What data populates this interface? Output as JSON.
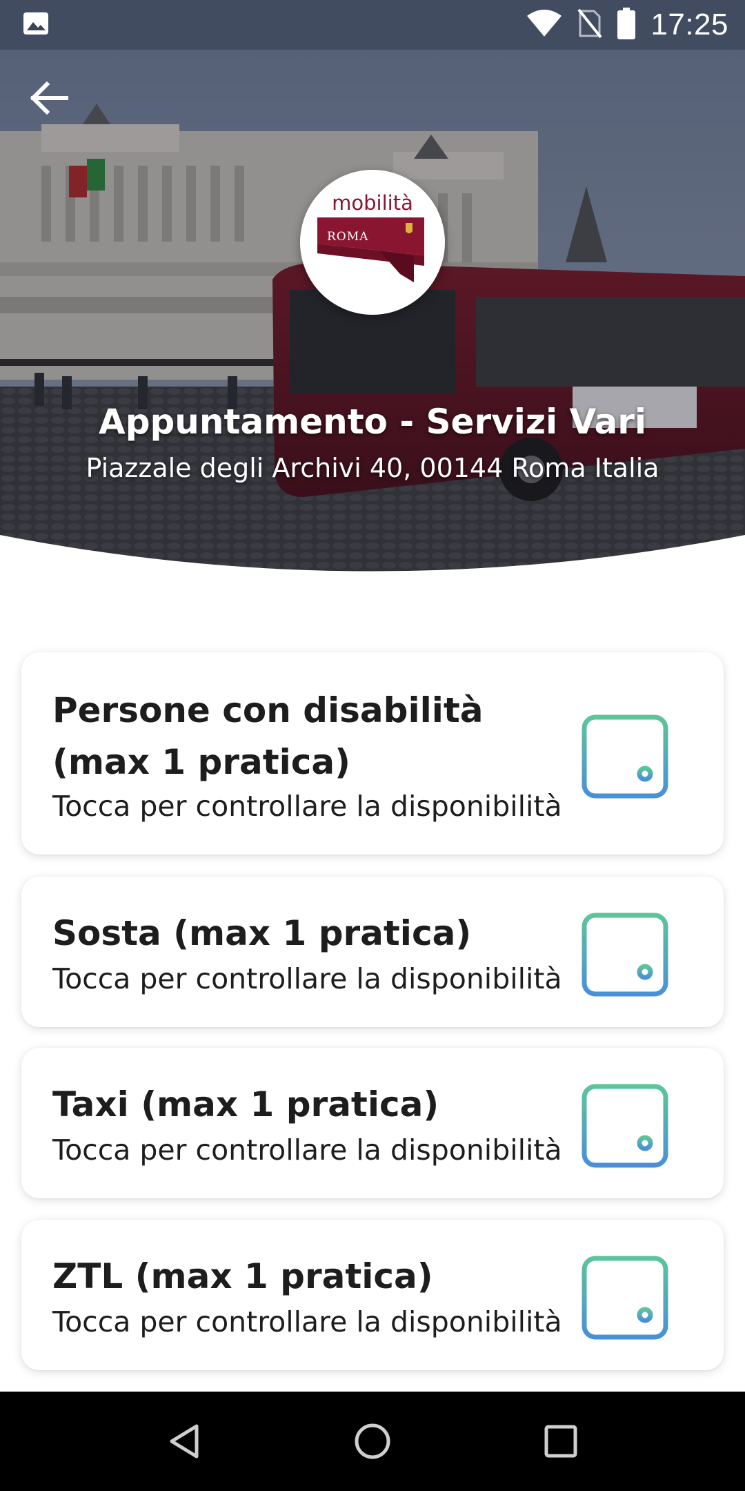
{
  "status_bar": {
    "time": "17:25",
    "icons": [
      "image-notification-icon",
      "wifi-icon",
      "no-sim-icon",
      "battery-icon"
    ]
  },
  "header": {
    "back_icon": "arrow-left-icon",
    "logo": {
      "text": "mobilità",
      "city": "ROMA"
    },
    "title": "Appuntamento - Servizi Vari",
    "address": "Piazzale degli Archivi 40, 00144 Roma Italia"
  },
  "services": [
    {
      "title": "Persone con disabilità (max 1 pratica)",
      "subtitle": "Tocca per controllare la disponibilità",
      "icon": "calendar-icon"
    },
    {
      "title": "Sosta (max 1 pratica)",
      "subtitle": "Tocca per controllare la disponibilità",
      "icon": "calendar-icon"
    },
    {
      "title": "Taxi (max 1 pratica)",
      "subtitle": "Tocca per controllare la disponibilità",
      "icon": "calendar-icon"
    },
    {
      "title": "ZTL (max 1 pratica)",
      "subtitle": "Tocca per controllare la disponibilità",
      "icon": "calendar-icon"
    }
  ],
  "nav_bar": {
    "icons": [
      "back-triangle-icon",
      "home-circle-icon",
      "recents-square-icon"
    ]
  },
  "colors": {
    "brand": "#8a1530",
    "icon_gradient_top": "#5cc59a",
    "icon_gradient_bottom": "#4a90d9",
    "text": "#1d1d1d"
  }
}
